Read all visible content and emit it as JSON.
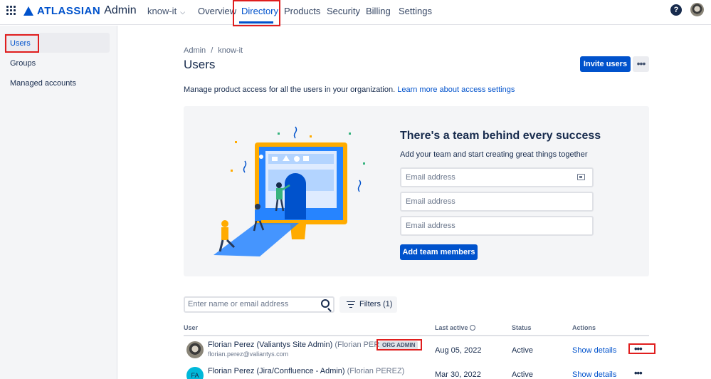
{
  "header": {
    "logo_text": "ATLASSIAN",
    "logo_sub": "Admin",
    "org_name": "know-it",
    "nav": [
      "Overview",
      "Directory",
      "Products",
      "Security",
      "Billing",
      "Settings"
    ],
    "active_nav": "Directory",
    "help_glyph": "?"
  },
  "sidebar": {
    "items": [
      {
        "label": "Users",
        "active": true
      },
      {
        "label": "Groups"
      },
      {
        "label": "Managed accounts"
      }
    ]
  },
  "breadcrumb": [
    "Admin",
    "know-it"
  ],
  "page": {
    "title": "Users",
    "invite_label": "Invite users",
    "more_glyph": "•••",
    "description": "Manage product access for all the users in your organization.",
    "learn_more": "Learn more about access settings"
  },
  "promo": {
    "title": "There's a team behind every success",
    "subtitle": "Add your team and start creating great things together",
    "email_placeholder": "Email address",
    "add_button": "Add team members"
  },
  "search": {
    "placeholder": "Enter name or email address"
  },
  "filters": {
    "label": "Filters (1)"
  },
  "table": {
    "headers": [
      "User",
      "Last active",
      "Status",
      "Actions"
    ],
    "rows": [
      {
        "name": "Florian Perez (Valiantys Site Admin)",
        "alias": "(Florian PEREZ)",
        "email": "florian.perez@valiantys.com",
        "badge": "ORG ADMIN",
        "last_active": "Aug 05, 2022",
        "status": "Active",
        "action": "Show details",
        "more": "•••"
      },
      {
        "name": "Florian Perez (Jira/Confluence - Admin)",
        "alias": "(Florian PEREZ)",
        "initials": "FA",
        "last_active": "Mar 30, 2022",
        "status": "Active",
        "action": "Show details",
        "more": "•••"
      }
    ]
  },
  "colors": {
    "brand": "#0052cc",
    "highlight": "#e01e1e",
    "teal_avatar": "#00b8d9"
  }
}
